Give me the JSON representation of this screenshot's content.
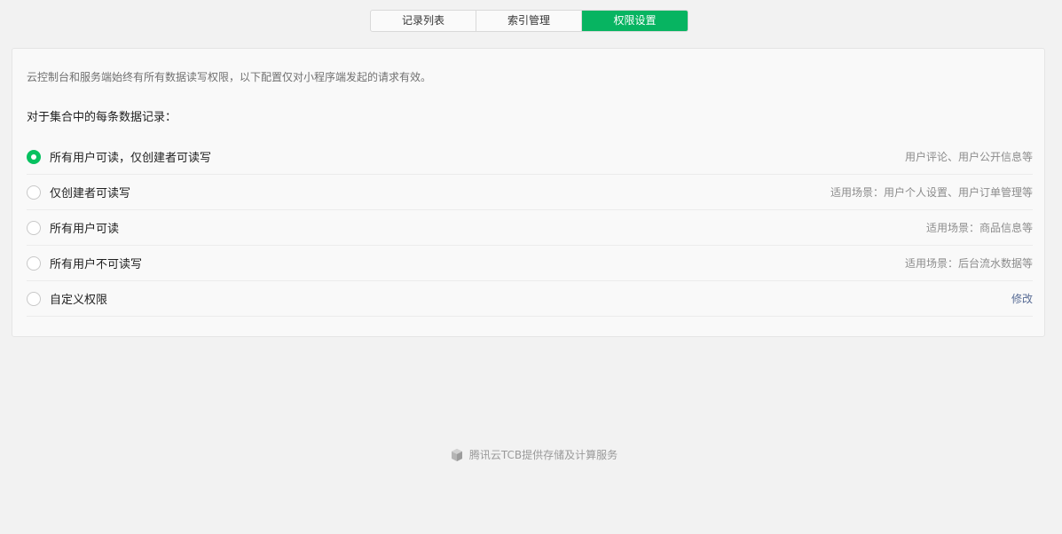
{
  "tabs": [
    {
      "label": "记录列表"
    },
    {
      "label": "索引管理"
    },
    {
      "label": "权限设置"
    }
  ],
  "active_tab": "权限设置",
  "notice": "云控制台和服务端始终有所有数据读写权限，以下配置仅对小程序端发起的请求有效。",
  "section_label": "对于集合中的每条数据记录：",
  "options": [
    {
      "label": "所有用户可读，仅创建者可读写",
      "hint": "用户评论、用户公开信息等",
      "checked": true
    },
    {
      "label": "仅创建者可读写",
      "hint": "适用场景：用户个人设置、用户订单管理等",
      "checked": false
    },
    {
      "label": "所有用户可读",
      "hint": "适用场景：商品信息等",
      "checked": false
    },
    {
      "label": "所有用户不可读写",
      "hint": "适用场景：后台流水数据等",
      "checked": false
    },
    {
      "label": "自定义权限",
      "link": "修改",
      "checked": false
    }
  ],
  "footer": {
    "text": "腾讯云TCB提供存储及计算服务",
    "icon": "tencent-cloud-logo-icon"
  },
  "colors": {
    "accent": "#07c160",
    "tab_active": "#07b461",
    "link": "#576b95"
  }
}
